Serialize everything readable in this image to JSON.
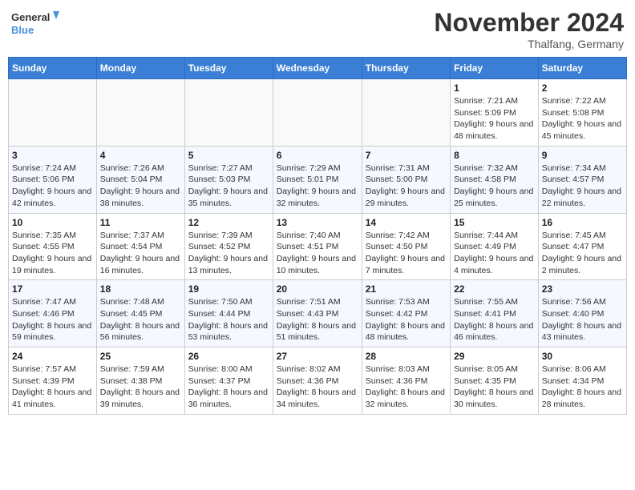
{
  "header": {
    "logo_line1": "General",
    "logo_line2": "Blue",
    "month_title": "November 2024",
    "location": "Thalfang, Germany"
  },
  "days_of_week": [
    "Sunday",
    "Monday",
    "Tuesday",
    "Wednesday",
    "Thursday",
    "Friday",
    "Saturday"
  ],
  "weeks": [
    [
      {
        "day": "",
        "sunrise": "",
        "sunset": "",
        "daylight": ""
      },
      {
        "day": "",
        "sunrise": "",
        "sunset": "",
        "daylight": ""
      },
      {
        "day": "",
        "sunrise": "",
        "sunset": "",
        "daylight": ""
      },
      {
        "day": "",
        "sunrise": "",
        "sunset": "",
        "daylight": ""
      },
      {
        "day": "",
        "sunrise": "",
        "sunset": "",
        "daylight": ""
      },
      {
        "day": "1",
        "sunrise": "Sunrise: 7:21 AM",
        "sunset": "Sunset: 5:09 PM",
        "daylight": "Daylight: 9 hours and 48 minutes."
      },
      {
        "day": "2",
        "sunrise": "Sunrise: 7:22 AM",
        "sunset": "Sunset: 5:08 PM",
        "daylight": "Daylight: 9 hours and 45 minutes."
      }
    ],
    [
      {
        "day": "3",
        "sunrise": "Sunrise: 7:24 AM",
        "sunset": "Sunset: 5:06 PM",
        "daylight": "Daylight: 9 hours and 42 minutes."
      },
      {
        "day": "4",
        "sunrise": "Sunrise: 7:26 AM",
        "sunset": "Sunset: 5:04 PM",
        "daylight": "Daylight: 9 hours and 38 minutes."
      },
      {
        "day": "5",
        "sunrise": "Sunrise: 7:27 AM",
        "sunset": "Sunset: 5:03 PM",
        "daylight": "Daylight: 9 hours and 35 minutes."
      },
      {
        "day": "6",
        "sunrise": "Sunrise: 7:29 AM",
        "sunset": "Sunset: 5:01 PM",
        "daylight": "Daylight: 9 hours and 32 minutes."
      },
      {
        "day": "7",
        "sunrise": "Sunrise: 7:31 AM",
        "sunset": "Sunset: 5:00 PM",
        "daylight": "Daylight: 9 hours and 29 minutes."
      },
      {
        "day": "8",
        "sunrise": "Sunrise: 7:32 AM",
        "sunset": "Sunset: 4:58 PM",
        "daylight": "Daylight: 9 hours and 25 minutes."
      },
      {
        "day": "9",
        "sunrise": "Sunrise: 7:34 AM",
        "sunset": "Sunset: 4:57 PM",
        "daylight": "Daylight: 9 hours and 22 minutes."
      }
    ],
    [
      {
        "day": "10",
        "sunrise": "Sunrise: 7:35 AM",
        "sunset": "Sunset: 4:55 PM",
        "daylight": "Daylight: 9 hours and 19 minutes."
      },
      {
        "day": "11",
        "sunrise": "Sunrise: 7:37 AM",
        "sunset": "Sunset: 4:54 PM",
        "daylight": "Daylight: 9 hours and 16 minutes."
      },
      {
        "day": "12",
        "sunrise": "Sunrise: 7:39 AM",
        "sunset": "Sunset: 4:52 PM",
        "daylight": "Daylight: 9 hours and 13 minutes."
      },
      {
        "day": "13",
        "sunrise": "Sunrise: 7:40 AM",
        "sunset": "Sunset: 4:51 PM",
        "daylight": "Daylight: 9 hours and 10 minutes."
      },
      {
        "day": "14",
        "sunrise": "Sunrise: 7:42 AM",
        "sunset": "Sunset: 4:50 PM",
        "daylight": "Daylight: 9 hours and 7 minutes."
      },
      {
        "day": "15",
        "sunrise": "Sunrise: 7:44 AM",
        "sunset": "Sunset: 4:49 PM",
        "daylight": "Daylight: 9 hours and 4 minutes."
      },
      {
        "day": "16",
        "sunrise": "Sunrise: 7:45 AM",
        "sunset": "Sunset: 4:47 PM",
        "daylight": "Daylight: 9 hours and 2 minutes."
      }
    ],
    [
      {
        "day": "17",
        "sunrise": "Sunrise: 7:47 AM",
        "sunset": "Sunset: 4:46 PM",
        "daylight": "Daylight: 8 hours and 59 minutes."
      },
      {
        "day": "18",
        "sunrise": "Sunrise: 7:48 AM",
        "sunset": "Sunset: 4:45 PM",
        "daylight": "Daylight: 8 hours and 56 minutes."
      },
      {
        "day": "19",
        "sunrise": "Sunrise: 7:50 AM",
        "sunset": "Sunset: 4:44 PM",
        "daylight": "Daylight: 8 hours and 53 minutes."
      },
      {
        "day": "20",
        "sunrise": "Sunrise: 7:51 AM",
        "sunset": "Sunset: 4:43 PM",
        "daylight": "Daylight: 8 hours and 51 minutes."
      },
      {
        "day": "21",
        "sunrise": "Sunrise: 7:53 AM",
        "sunset": "Sunset: 4:42 PM",
        "daylight": "Daylight: 8 hours and 48 minutes."
      },
      {
        "day": "22",
        "sunrise": "Sunrise: 7:55 AM",
        "sunset": "Sunset: 4:41 PM",
        "daylight": "Daylight: 8 hours and 46 minutes."
      },
      {
        "day": "23",
        "sunrise": "Sunrise: 7:56 AM",
        "sunset": "Sunset: 4:40 PM",
        "daylight": "Daylight: 8 hours and 43 minutes."
      }
    ],
    [
      {
        "day": "24",
        "sunrise": "Sunrise: 7:57 AM",
        "sunset": "Sunset: 4:39 PM",
        "daylight": "Daylight: 8 hours and 41 minutes."
      },
      {
        "day": "25",
        "sunrise": "Sunrise: 7:59 AM",
        "sunset": "Sunset: 4:38 PM",
        "daylight": "Daylight: 8 hours and 39 minutes."
      },
      {
        "day": "26",
        "sunrise": "Sunrise: 8:00 AM",
        "sunset": "Sunset: 4:37 PM",
        "daylight": "Daylight: 8 hours and 36 minutes."
      },
      {
        "day": "27",
        "sunrise": "Sunrise: 8:02 AM",
        "sunset": "Sunset: 4:36 PM",
        "daylight": "Daylight: 8 hours and 34 minutes."
      },
      {
        "day": "28",
        "sunrise": "Sunrise: 8:03 AM",
        "sunset": "Sunset: 4:36 PM",
        "daylight": "Daylight: 8 hours and 32 minutes."
      },
      {
        "day": "29",
        "sunrise": "Sunrise: 8:05 AM",
        "sunset": "Sunset: 4:35 PM",
        "daylight": "Daylight: 8 hours and 30 minutes."
      },
      {
        "day": "30",
        "sunrise": "Sunrise: 8:06 AM",
        "sunset": "Sunset: 4:34 PM",
        "daylight": "Daylight: 8 hours and 28 minutes."
      }
    ]
  ]
}
